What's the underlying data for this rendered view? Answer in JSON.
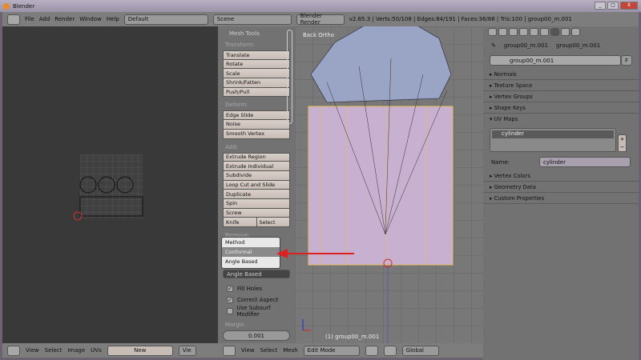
{
  "window": {
    "title": "Blender"
  },
  "topbar": {
    "menus": [
      "File",
      "Add",
      "Render",
      "Window",
      "Help"
    ],
    "layout": "Default",
    "scene": "Scene",
    "engine": "Blender Render",
    "stats": "v2.65.3 | Verts:50/108 | Edges:84/191 | Faces:36/88 | Tris:100 | group00_m.001"
  },
  "tools": {
    "header": "Mesh Tools",
    "sections": [
      {
        "title": "Transform:",
        "buttons": [
          "Translate",
          "Rotate",
          "Scale",
          "Shrink/Fatten",
          "Push/Pull"
        ]
      },
      {
        "title": "Deform:",
        "buttons": [
          "Edge Slide",
          "Noise",
          "Smooth Vertex"
        ]
      },
      {
        "title": "Add:",
        "buttons": [
          "Extrude Region",
          "Extrude Individual",
          "Subdivide",
          "Loop Cut and Slide",
          "Duplicate",
          "Spin",
          "Screw"
        ]
      }
    ],
    "knife": "Knife",
    "select": "Select",
    "remove": "Remove:",
    "dropdown": {
      "title": "Method",
      "options": [
        "Conformal",
        "Angle Based"
      ],
      "highlighted": "Conformal"
    },
    "method_value": "Angle Based",
    "checks": [
      {
        "label": "Fill Holes",
        "checked": true
      },
      {
        "label": "Correct Aspect",
        "checked": true
      },
      {
        "label": "Use Subsurf Modifier",
        "checked": false
      }
    ],
    "margin_label": "Margin",
    "margin_value": "0.001"
  },
  "viewport": {
    "label": "Back Ortho",
    "object": "(1) group00_m.001"
  },
  "props": {
    "breadcrumb": [
      "group00_m.001",
      "group00_m.001"
    ],
    "mesh_name": "group00_m.001",
    "fake_user": "F",
    "panels_top": [
      "Normals",
      "Texture Space",
      "Vertex Groups",
      "Shape Keys"
    ],
    "uv_maps": "UV Maps",
    "uv_item": "cylinder",
    "name_label": "Name:",
    "name_value": "cylinder",
    "panels_bottom": [
      "Vertex Colors",
      "Geometry Data",
      "Custom Properties"
    ]
  },
  "uv_bar": {
    "menus": [
      "View",
      "Select",
      "Image",
      "UVs"
    ],
    "new": "New",
    "view": "Vie"
  },
  "view_bar": {
    "menus": [
      "View",
      "Select",
      "Mesh"
    ],
    "mode": "Edit Mode",
    "orientation": "Global"
  },
  "colors": {
    "arrow": "#e02020",
    "selected_edge": "#e8c060",
    "mesh": "#c8b0d0"
  }
}
